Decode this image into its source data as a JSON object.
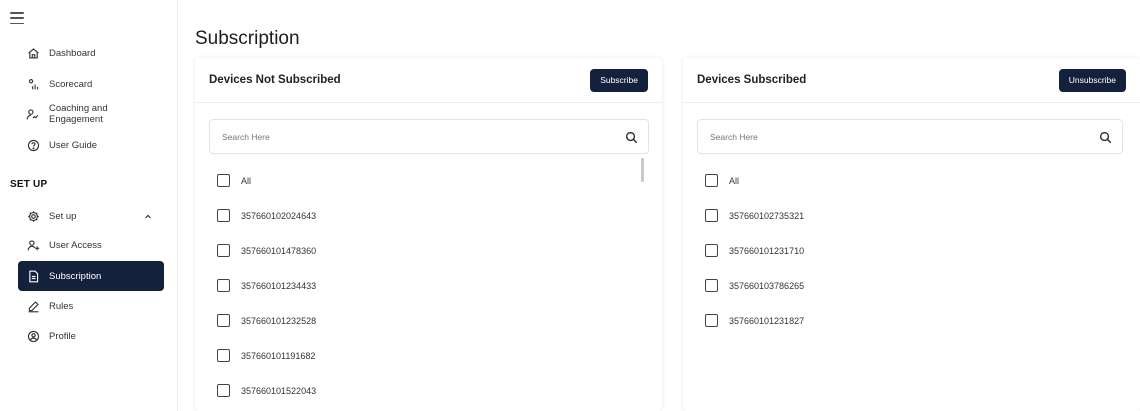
{
  "sidebar": {
    "items": [
      {
        "label": "Dashboard",
        "icon": "home-icon"
      },
      {
        "label": "Scorecard",
        "icon": "scorecard-icon"
      },
      {
        "label": "Coaching and Engagement",
        "icon": "coaching-icon"
      },
      {
        "label": "User Guide",
        "icon": "help-circle-icon"
      }
    ],
    "section_title": "SET UP",
    "setup_items": [
      {
        "label": "Set up",
        "icon": "gear-icon",
        "expanded": true
      },
      {
        "label": "User Access",
        "icon": "user-plus-icon"
      },
      {
        "label": "Subscription",
        "icon": "document-icon",
        "active": true
      },
      {
        "label": "Rules",
        "icon": "edit-icon"
      },
      {
        "label": "Profile",
        "icon": "profile-icon"
      }
    ]
  },
  "main": {
    "title": "Subscription",
    "left_panel": {
      "title": "Devices Not Subscribed",
      "button_label": "Subscribe",
      "search_placeholder": "Search Here",
      "items": [
        "All",
        "357660102024643",
        "357660101478360",
        "357660101234433",
        "357660101232528",
        "357660101191682",
        "357660101522043"
      ]
    },
    "right_panel": {
      "title": "Devices Subscribed",
      "button_label": "Unsubscribe",
      "search_placeholder": "Search Here",
      "items": [
        "All",
        "357660102735321",
        "357660101231710",
        "357660103786265",
        "357660101231827"
      ]
    }
  },
  "colors": {
    "accent": "#14213d",
    "border": "#e3e3e3"
  }
}
